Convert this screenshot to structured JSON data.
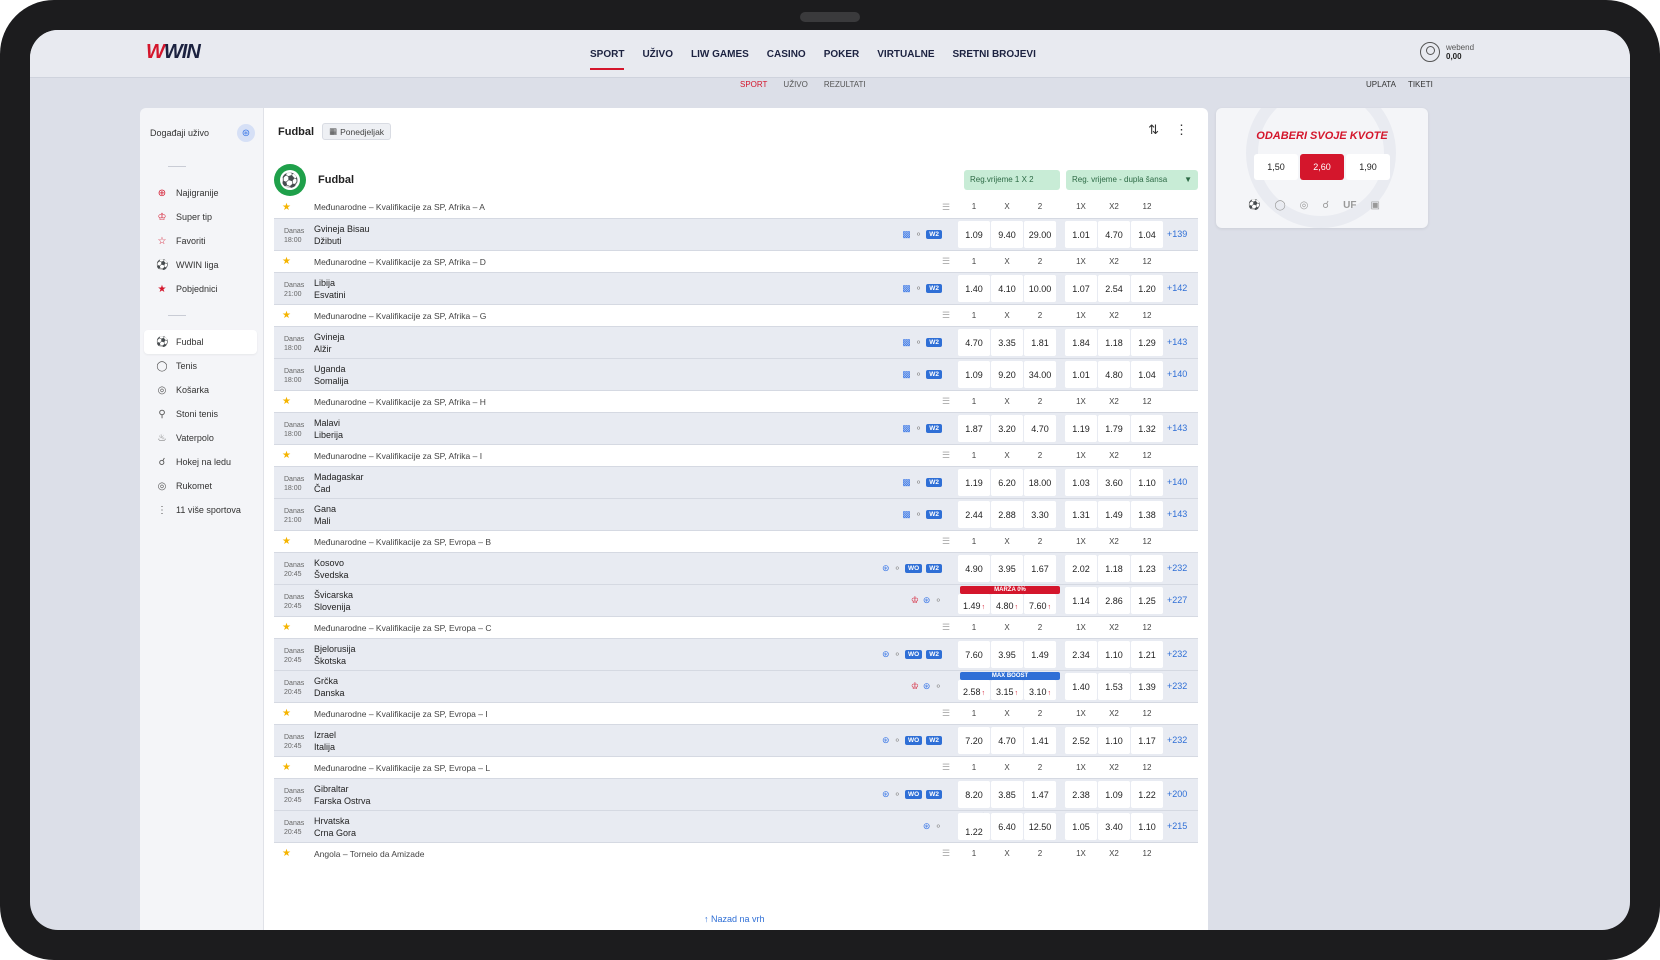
{
  "brand": {
    "logo_w": "W",
    "logo_rest": "WIN"
  },
  "nav": {
    "items": [
      {
        "label": "SPORT",
        "active": true
      },
      {
        "label": "UŽIVO"
      },
      {
        "label": "LIW GAMES"
      },
      {
        "label": "CASINO"
      },
      {
        "label": "POKER"
      },
      {
        "label": "VIRTUALNE"
      },
      {
        "label": "SRETNI BROJEVI"
      }
    ]
  },
  "user": {
    "name": "webend",
    "balance": "0,00"
  },
  "subnav": {
    "items": [
      {
        "label": "SPORT",
        "active": true
      },
      {
        "label": "UŽIVO"
      },
      {
        "label": "REZULTATI"
      }
    ]
  },
  "rightlinks": {
    "uplata": "UPLATA",
    "tiketi": "TIKETI"
  },
  "sidebar": {
    "live_title": "Događaji uživo",
    "top_items": [
      {
        "label": "Najigranije",
        "icon": "target-icon"
      },
      {
        "label": "Super tip",
        "icon": "crown-icon"
      },
      {
        "label": "Favoriti",
        "icon": "star-icon"
      },
      {
        "label": "WWIN liga",
        "icon": "ball-icon"
      },
      {
        "label": "Pobjednici",
        "icon": "trophy-icon"
      }
    ],
    "sports": [
      {
        "label": "Fudbal",
        "active": true
      },
      {
        "label": "Tenis"
      },
      {
        "label": "Košarka"
      },
      {
        "label": "Stoni tenis"
      },
      {
        "label": "Vaterpolo"
      },
      {
        "label": "Hokej na ledu"
      },
      {
        "label": "Rukomet"
      },
      {
        "label": "11 više sportova"
      }
    ]
  },
  "main": {
    "title": "Fudbal",
    "day": "Ponedjeljak",
    "sport_title": "Fudbal",
    "market1": "Reg.vrijeme 1 X 2",
    "market2": "Reg. vrijeme - dupla šansa",
    "back_to_top": "Nazad na vrh",
    "headers": [
      "1",
      "X",
      "2",
      "1X",
      "X2",
      "12"
    ]
  },
  "groups": [
    {
      "name": "Međunarodne – Kvalifikacije za SP, Afrika – A",
      "matches": [
        {
          "day": "Danas",
          "time": "18:00",
          "home": "Gvineja Bisau",
          "away": "Džibuti",
          "odds": [
            "1.09",
            "9.40",
            "29.00",
            "1.01",
            "4.70",
            "1.04"
          ],
          "more": "+139",
          "kind": "a"
        }
      ]
    },
    {
      "name": "Međunarodne – Kvalifikacije za SP, Afrika – D",
      "matches": [
        {
          "day": "Danas",
          "time": "21:00",
          "home": "Libija",
          "away": "Esvatini",
          "odds": [
            "1.40",
            "4.10",
            "10.00",
            "1.07",
            "2.54",
            "1.20"
          ],
          "more": "+142",
          "kind": "a"
        }
      ]
    },
    {
      "name": "Međunarodne – Kvalifikacije za SP, Afrika – G",
      "matches": [
        {
          "day": "Danas",
          "time": "18:00",
          "home": "Gvineja",
          "away": "Alžir",
          "odds": [
            "4.70",
            "3.35",
            "1.81",
            "1.84",
            "1.18",
            "1.29"
          ],
          "more": "+143",
          "kind": "a"
        },
        {
          "day": "Danas",
          "time": "18:00",
          "home": "Uganda",
          "away": "Somalija",
          "odds": [
            "1.09",
            "9.20",
            "34.00",
            "1.01",
            "4.80",
            "1.04"
          ],
          "more": "+140",
          "kind": "a"
        }
      ]
    },
    {
      "name": "Međunarodne – Kvalifikacije za SP, Afrika – H",
      "matches": [
        {
          "day": "Danas",
          "time": "18:00",
          "home": "Malavi",
          "away": "Liberija",
          "odds": [
            "1.87",
            "3.20",
            "4.70",
            "1.19",
            "1.79",
            "1.32"
          ],
          "more": "+143",
          "kind": "a"
        }
      ]
    },
    {
      "name": "Međunarodne – Kvalifikacije za SP, Afrika – I",
      "matches": [
        {
          "day": "Danas",
          "time": "18:00",
          "home": "Madagaskar",
          "away": "Čad",
          "odds": [
            "1.19",
            "6.20",
            "18.00",
            "1.03",
            "3.60",
            "1.10"
          ],
          "more": "+140",
          "kind": "a"
        },
        {
          "day": "Danas",
          "time": "21:00",
          "home": "Gana",
          "away": "Mali",
          "odds": [
            "2.44",
            "2.88",
            "3.30",
            "1.31",
            "1.49",
            "1.38"
          ],
          "more": "+143",
          "kind": "a"
        }
      ]
    },
    {
      "name": "Međunarodne – Kvalifikacije za SP, Evropa – B",
      "matches": [
        {
          "day": "Danas",
          "time": "20:45",
          "home": "Kosovo",
          "away": "Švedska",
          "odds": [
            "4.90",
            "3.95",
            "1.67",
            "2.02",
            "1.18",
            "1.23"
          ],
          "more": "+232",
          "kind": "b"
        },
        {
          "day": "Danas",
          "time": "20:45",
          "home": "Švicarska",
          "away": "Slovenija",
          "odds": [
            "1.49",
            "4.80",
            "7.60",
            "1.14",
            "2.86",
            "1.25"
          ],
          "more": "+227",
          "kind": "c",
          "promo": "MARŽA 0%",
          "promo_color": "red"
        }
      ]
    },
    {
      "name": "Međunarodne – Kvalifikacije za SP, Evropa – C",
      "matches": [
        {
          "day": "Danas",
          "time": "20:45",
          "home": "Bjelorusija",
          "away": "Škotska",
          "odds": [
            "7.60",
            "3.95",
            "1.49",
            "2.34",
            "1.10",
            "1.21"
          ],
          "more": "+232",
          "kind": "b"
        },
        {
          "day": "Danas",
          "time": "20:45",
          "home": "Grčka",
          "away": "Danska",
          "odds": [
            "2.58",
            "3.15",
            "3.10",
            "1.40",
            "1.53",
            "1.39"
          ],
          "more": "+232",
          "kind": "c",
          "promo": "MAX BOOST",
          "promo_color": "blue"
        }
      ]
    },
    {
      "name": "Međunarodne – Kvalifikacije za SP, Evropa – I",
      "matches": [
        {
          "day": "Danas",
          "time": "20:45",
          "home": "Izrael",
          "away": "Italija",
          "odds": [
            "7.20",
            "4.70",
            "1.41",
            "2.52",
            "1.10",
            "1.17"
          ],
          "more": "+232",
          "kind": "b"
        }
      ]
    },
    {
      "name": "Međunarodne – Kvalifikacije za SP, Evropa – L",
      "matches": [
        {
          "day": "Danas",
          "time": "20:45",
          "home": "Gibraltar",
          "away": "Farska Ostrva",
          "odds": [
            "8.20",
            "3.85",
            "1.47",
            "2.38",
            "1.09",
            "1.22"
          ],
          "more": "+200",
          "kind": "b"
        },
        {
          "day": "Danas",
          "time": "20:45",
          "home": "Hrvatska",
          "away": "Crna Gora",
          "odds": [
            "1.22",
            "6.40",
            "12.50",
            "1.05",
            "3.40",
            "1.10"
          ],
          "more": "+215",
          "kind": "d"
        }
      ]
    },
    {
      "name": "Angola – Torneio da Amizade",
      "matches": []
    }
  ],
  "widget": {
    "title": "ODABERI SVOJE KVOTE",
    "odds": [
      {
        "value": "1,50"
      },
      {
        "value": "2,60",
        "selected": true
      },
      {
        "value": "1,90"
      }
    ]
  },
  "colors": {
    "accent": "#d4162c",
    "link": "#2f6fd6",
    "green": "#1fa04a"
  }
}
